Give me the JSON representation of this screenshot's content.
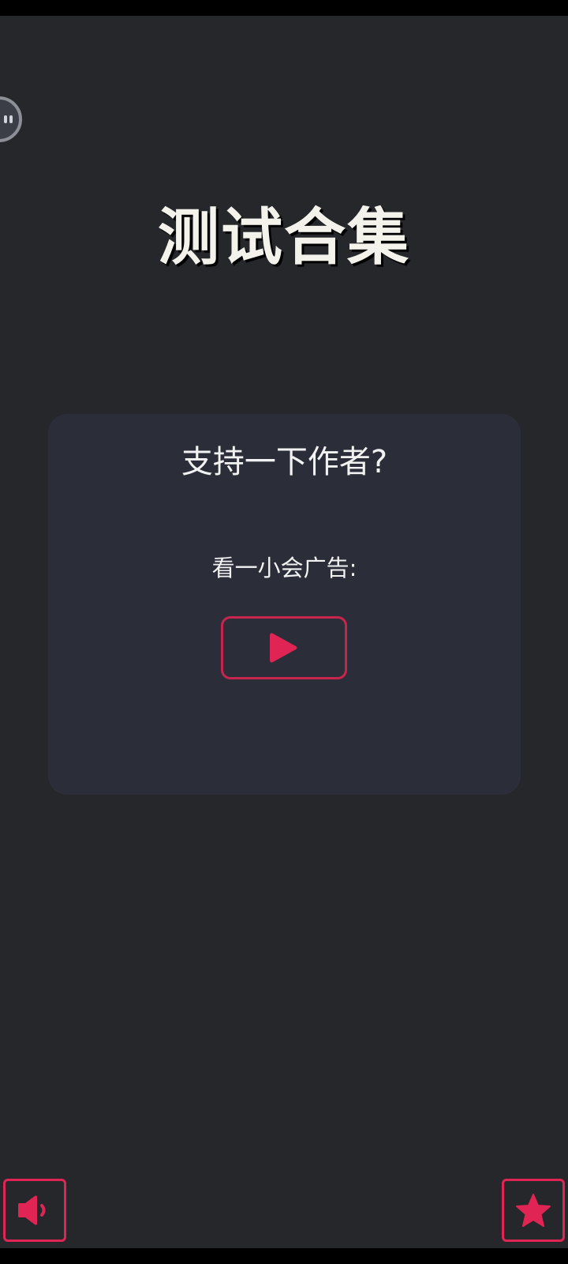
{
  "header": {
    "title": "测试合集"
  },
  "support_card": {
    "heading": "支持一下作者?",
    "subtext": "看一小会广告:",
    "play_icon": "play-icon"
  },
  "bottom_controls": {
    "sound_icon": "speaker-icon",
    "favorite_icon": "star-icon"
  },
  "floating_bubble": {
    "icon": "chat-bubble-icon"
  },
  "colors": {
    "background": "#26272b",
    "card": "#2b2e38",
    "accent": "#e02454",
    "text": "#f3f3ec"
  }
}
